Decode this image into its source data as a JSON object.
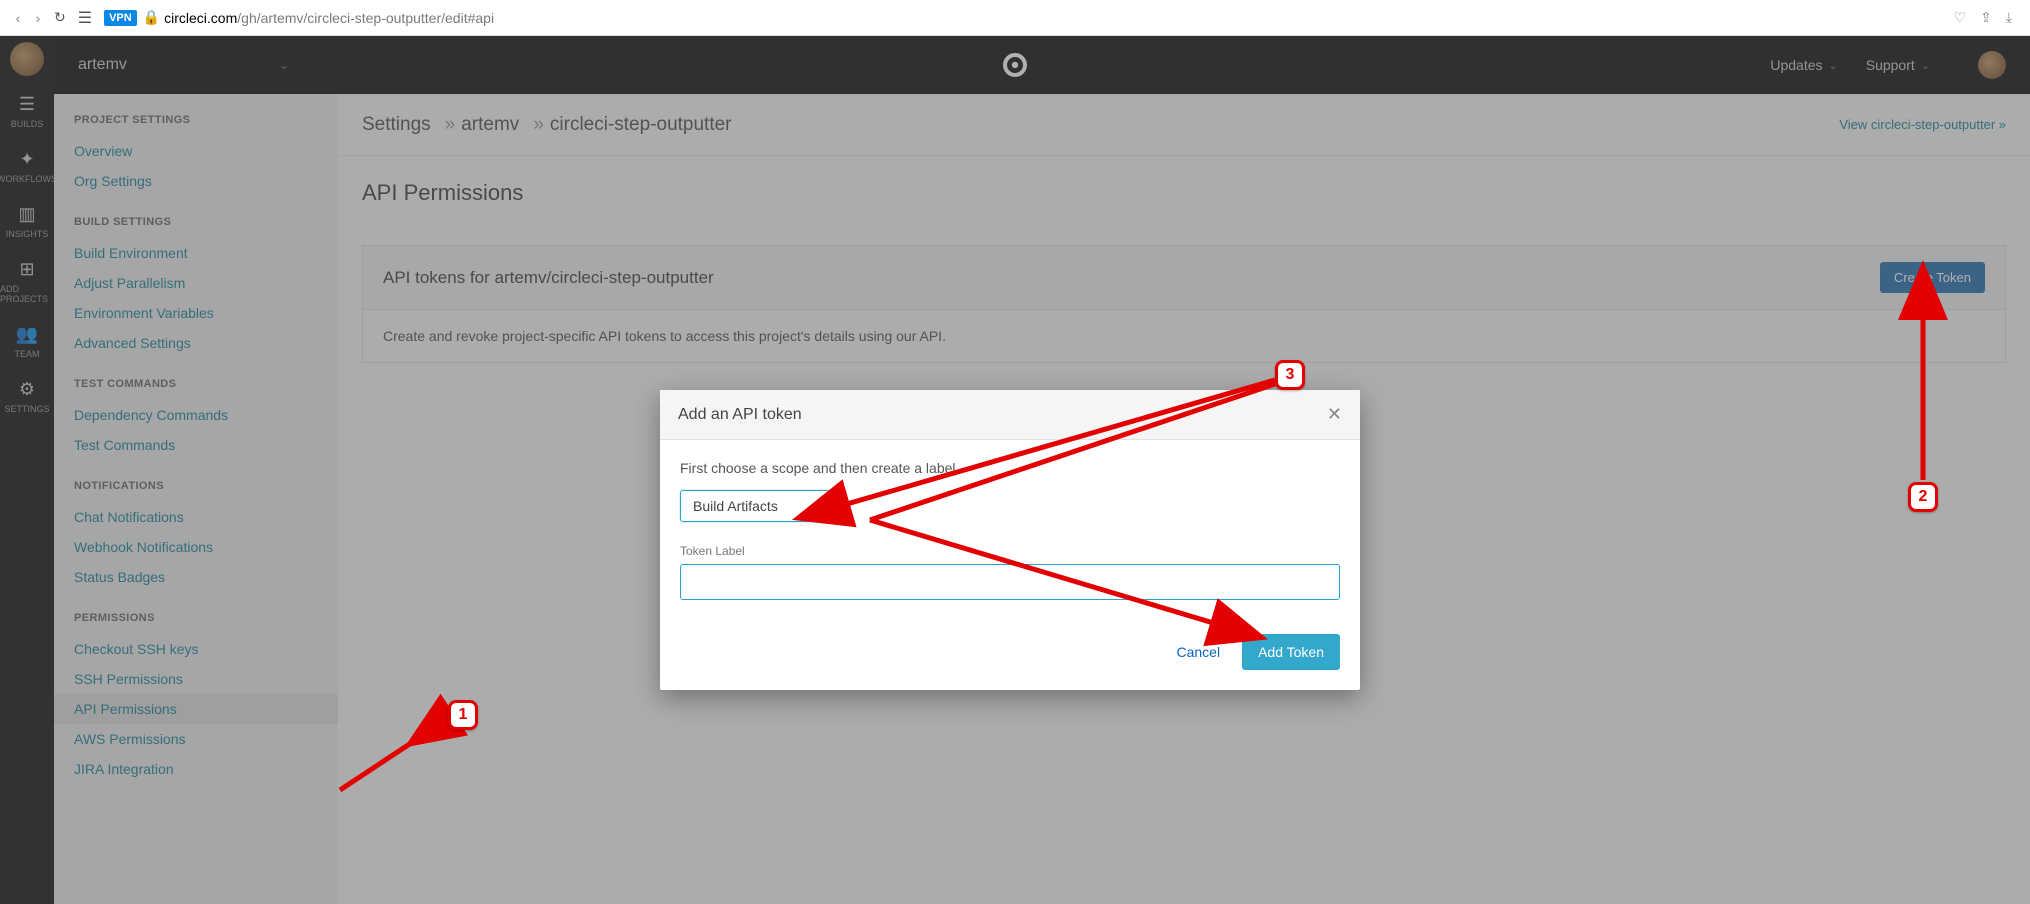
{
  "browser": {
    "url_domain": "circleci.com",
    "url_path": "/gh/artemv/circleci-step-outputter/edit#api",
    "vpn": "VPN"
  },
  "rail": {
    "items": [
      {
        "label": "BUILDS"
      },
      {
        "label": "WORKFLOWS"
      },
      {
        "label": "INSIGHTS"
      },
      {
        "label": "ADD PROJECTS"
      },
      {
        "label": "TEAM"
      },
      {
        "label": "SETTINGS"
      }
    ]
  },
  "topbar": {
    "org": "artemv",
    "updates": "Updates",
    "support": "Support"
  },
  "breadcrumb": {
    "root": "Settings",
    "org": "artemv",
    "project": "circleci-step-outputter",
    "view_link": "View circleci-step-outputter »"
  },
  "page": {
    "title": "API Permissions",
    "panel_title": "API tokens for artemv/circleci-step-outputter",
    "create_token": "Create Token",
    "panel_desc": "Create and revoke project-specific API tokens to access this project's details using our API."
  },
  "sidebar": {
    "groups": [
      {
        "title": "PROJECT SETTINGS",
        "items": [
          "Overview",
          "Org Settings"
        ]
      },
      {
        "title": "BUILD SETTINGS",
        "items": [
          "Build Environment",
          "Adjust Parallelism",
          "Environment Variables",
          "Advanced Settings"
        ]
      },
      {
        "title": "TEST COMMANDS",
        "items": [
          "Dependency Commands",
          "Test Commands"
        ]
      },
      {
        "title": "NOTIFICATIONS",
        "items": [
          "Chat Notifications",
          "Webhook Notifications",
          "Status Badges"
        ]
      },
      {
        "title": "PERMISSIONS",
        "items": [
          "Checkout SSH keys",
          "SSH Permissions",
          "API Permissions",
          "AWS Permissions",
          "JIRA Integration"
        ]
      }
    ],
    "active": "API Permissions"
  },
  "modal": {
    "title": "Add an API token",
    "hint": "First choose a scope and then create a label.",
    "scope_value": "Build Artifacts",
    "token_label": "Token Label",
    "cancel": "Cancel",
    "add": "Add Token"
  },
  "annotations": {
    "m1": "1",
    "m2": "2",
    "m3": "3"
  }
}
